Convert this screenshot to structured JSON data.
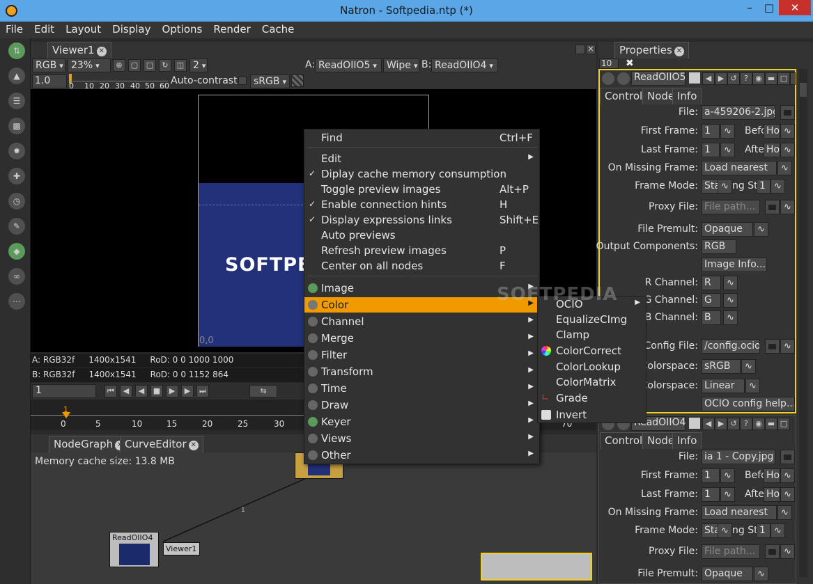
{
  "window": {
    "title": "Natron - Softpedia.ntp (*)",
    "min": "–",
    "max": "□",
    "close": "✕"
  },
  "menubar": [
    "File",
    "Edit",
    "Layout",
    "Display",
    "Options",
    "Render",
    "Cache"
  ],
  "viewer": {
    "tab": "Viewer1",
    "channels": "RGB",
    "zoom": "23%",
    "subsample": "2",
    "input_a_label": "A:",
    "input_a": "ReadOIIO5",
    "wipe": "Wipe",
    "input_b_label": "B:",
    "input_b": "ReadOIIO4",
    "gain": "1.0",
    "ruler": [
      "0",
      "10",
      "20",
      "30",
      "40",
      "50",
      "60"
    ],
    "auto_contrast": "Auto-contrast:",
    "colorspace": "sRGB",
    "origin": "0,0",
    "logo_text": "SOFTPE",
    "info_a": {
      "fmt": "A: RGB32f",
      "res": "1400x1541",
      "rod": "RoD: 0 0 1000 1000"
    },
    "info_b": {
      "fmt": "B: RGB32f",
      "res": "1400x1541",
      "rod": "RoD: 0 0 1152 864"
    },
    "frame": "1",
    "timeline_current": "1",
    "timeline_ticks": [
      "0",
      "5",
      "10",
      "15",
      "20",
      "25",
      "30",
      "70"
    ]
  },
  "nodegraph": {
    "tabs": [
      "NodeGraph",
      "CurveEditor"
    ],
    "memory": "Memory cache size: 13.8 MB",
    "nodes": {
      "read": "ReadOIIO4",
      "viewer": "Viewer1",
      "link_label": "1"
    },
    "thumb_text": "SOFTPEDIA"
  },
  "context_menu": {
    "find": {
      "label": "Find",
      "shortcut": "Ctrl+F"
    },
    "edit": "Edit",
    "options": [
      {
        "label": "Diplay cache memory consumption",
        "checked": true,
        "shortcut": ""
      },
      {
        "label": "Toggle preview images",
        "checked": false,
        "shortcut": "Alt+P"
      },
      {
        "label": "Enable connection hints",
        "checked": true,
        "shortcut": "H"
      },
      {
        "label": "Display expressions links",
        "checked": true,
        "shortcut": "Shift+E"
      },
      {
        "label": "Auto previews",
        "checked": false,
        "shortcut": ""
      },
      {
        "label": "Refresh preview images",
        "checked": false,
        "shortcut": "P"
      },
      {
        "label": "Center on all nodes",
        "checked": false,
        "shortcut": "F"
      }
    ],
    "categories": [
      "Image",
      "Color",
      "Channel",
      "Merge",
      "Filter",
      "Transform",
      "Time",
      "Draw",
      "Keyer",
      "Views",
      "Other"
    ],
    "highlighted": "Color"
  },
  "color_submenu": [
    "OCIO",
    "EqualizeCImg",
    "Clamp",
    "ColorCorrect",
    "ColorLookup",
    "ColorMatrix",
    "Grade",
    "Invert"
  ],
  "properties": {
    "tab": "Properties",
    "max_panels": "10",
    "node1": {
      "name": "ReadOIIO5",
      "tabs": [
        "Controls",
        "Node",
        "Info"
      ],
      "file_label": "File:",
      "file": "a-459206-2.jpg",
      "first_frame_label": "First Frame:",
      "first_frame": "1",
      "before": "Befo",
      "before_val": "Ho",
      "last_frame_label": "Last Frame:",
      "last_frame": "1",
      "after": "Afte",
      "after_val": "Ho",
      "on_missing_label": "On Missing Frame:",
      "on_missing": "Load nearest",
      "frame_mode_label": "Frame Mode:",
      "frame_mode": "Sta",
      "frame_mode_text": "ng Sta",
      "frame_mode_num": "1",
      "proxy_label": "Proxy File:",
      "proxy_placeholder": "File path...",
      "premult_label": "File Premult:",
      "premult": "Opaque",
      "output_label": "Output Components:",
      "output": "RGB",
      "image_info": "Image Info...",
      "r_label": "R Channel:",
      "r": "R",
      "g_label": "G Channel:",
      "g": "G",
      "b_label": "B Channel:",
      "b": "B",
      "config_label": "Config File:",
      "config": "/config.ocio",
      "cs1_label": "Colorspace:",
      "cs1": "sRGB",
      "cs2_label": "Colorspace:",
      "cs2": "Linear",
      "ocio_help": "OCIO config help..."
    },
    "node2": {
      "name": "ReadOIIO4",
      "tabs": [
        "Controls",
        "Node",
        "Info"
      ],
      "file_label": "File:",
      "file": "ia 1 - Copy.jpg",
      "first_frame_label": "First Frame:",
      "first_frame": "1",
      "before": "Befo",
      "before_val": "Ho",
      "last_frame_label": "Last Frame:",
      "last_frame": "1",
      "after": "Afte",
      "after_val": "Ho",
      "on_missing_label": "On Missing Frame:",
      "on_missing": "Load nearest",
      "frame_mode_label": "Frame Mode:",
      "frame_mode": "Sta",
      "frame_mode_text": "ng Sta",
      "frame_mode_num": "1",
      "proxy_label": "Proxy File:",
      "proxy_placeholder": "File path...",
      "premult_label": "File Premult:",
      "premult": "Opaque"
    }
  },
  "watermark": "SOFTPEDIA",
  "colors": {
    "highlight": "#f09a00",
    "titlebar": "#5aa6e6",
    "image_blue": "#22317a",
    "node_selected": "#f0d020"
  }
}
